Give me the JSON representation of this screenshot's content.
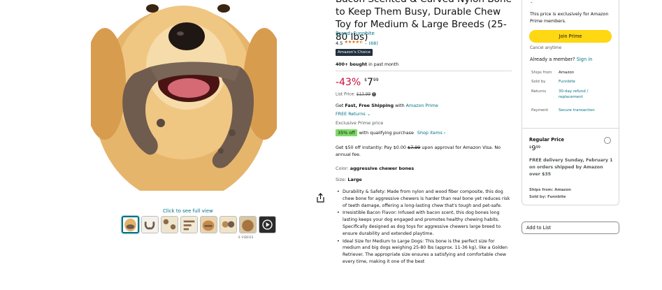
{
  "gallery": {
    "click_label": "Click to see full view",
    "videos_label": "6 VIDEOS",
    "thumbnail_count": 8
  },
  "product": {
    "title": "Bacon Scented & Curved Nylon Bone to Keep Them Busy, Durable Chew Toy for Medium & Large Breeds (25-80 lbs)",
    "brand": "Brand: Funnbite",
    "rating_value": "4.5",
    "stars": "★★★★⯪",
    "rating_fraction": 0.9,
    "rating_count": "(68)",
    "badge": "Amazon's Choice",
    "bought_bold": "400+ bought",
    "bought_rest": " in past month",
    "discount": "-43%",
    "currency": "$",
    "price_whole": "7",
    "price_fraction": "99",
    "list_price_label": "List Price: ",
    "list_price": "$13.99",
    "info_icon": "i",
    "ship_prefix": "Get ",
    "ship_bold": "Fast, Free Shipping",
    "ship_mid": " with ",
    "ship_link": "Amazon Prime",
    "returns": "FREE Returns",
    "returns_chevron": "⌄",
    "exclusive": "Exclusive Prime price",
    "pct_badge": "35% off",
    "pct_text": "with qualifying purchase",
    "shop_items": "Shop items ›",
    "offer_pre": "Get $50 off instantly: Pay $0.00 ",
    "offer_strike": "$7.99",
    "offer_post": " upon approval for Amazon Visa. No annual fee.",
    "color_label": "Color: ",
    "color_value": "aggressive chewer bones",
    "size_label": "Size: ",
    "size_value": "Large",
    "bullets": [
      "Durability & Safety: Made from nylon and wood fiber composite, this dog chew bone for aggressive chewers is harder than real bone yet reduces risk of teeth damage, offering a long-lasting chew that's tough and pet-safe.",
      "Irresistible Bacon Flavor: Infused with bacon scent, this dog bones long lasting keeps your dog engaged and promotes healthy chewing habits. Specifically designed as dog toys for aggressive chewers large breed to ensure durability and extended playtime.",
      "Ideal Size for Medium to Large Dogs: This bone is the perfect size for medium and big dogs weighing 25-80 lbs (approx. 11-36 kg), like a Golden Retriever. The appropriate size ensures a satisfying and comfortable chew every time, making it one of the best"
    ]
  },
  "buybox": {
    "top_fragment": "-",
    "prime_note": "This price is exclusively for Amazon Prime members.",
    "join_prime": "Join Prime",
    "cancel": "Cancel anytime",
    "already": "Already a member? ",
    "sign_in": "Sign in",
    "ships_from_label": "Ships from",
    "ships_from_value": "Amazon",
    "sold_by_label": "Sold by",
    "sold_by_value": "Funnbite",
    "returns_label": "Returns",
    "returns_value_1": "30-day refund /",
    "returns_value_2": "replacement",
    "payment_label": "Payment",
    "payment_value": "Secure transaction",
    "regular_price_label": "Regular Price",
    "regular_currency": "$",
    "regular_whole": "9",
    "regular_fraction": "99",
    "delivery": "FREE delivery Sunday, February 1 on orders shipped by Amazon over $35",
    "ships_from_2": "Ships from: Amazon",
    "sold_by_2": "Sold by: Funnbite",
    "add_to_list": "Add to List"
  },
  "colors": {
    "link": "#007185",
    "deal_red": "#cc0c39",
    "prime_button": "#ffd814",
    "badge_dark": "#232f3e",
    "star": "#de7921",
    "pct_green": "#7fda69"
  }
}
